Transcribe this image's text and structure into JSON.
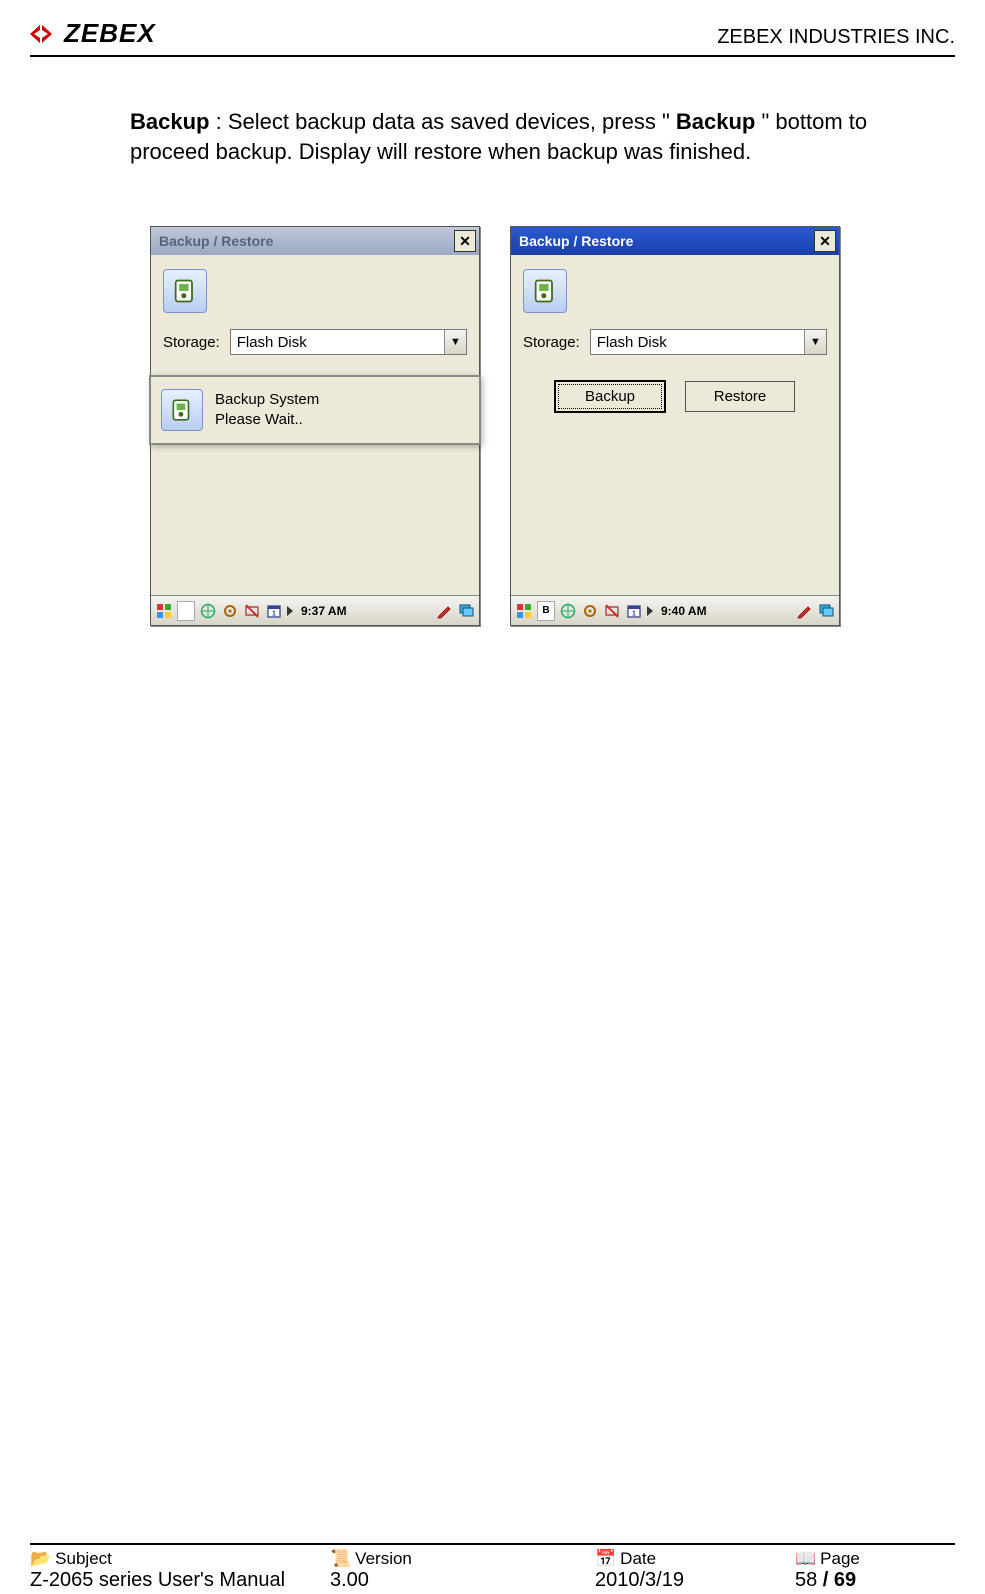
{
  "header": {
    "logo_text": "ZEBEX",
    "company": "ZEBEX INDUSTRIES INC."
  },
  "body": {
    "p1_bold1": "Backup",
    "p1_text1": " : Select backup data as saved devices, press \" ",
    "p1_bold2": "Backup",
    "p1_text2": " \" bottom to proceed backup. Display will restore when backup was finished."
  },
  "win_a": {
    "title": "Backup / Restore",
    "storage_label": "Storage:",
    "storage_value": "Flash Disk",
    "msg_line1": "Backup System",
    "msg_line2": "Please Wait..",
    "clock": "9:37 AM",
    "slot_char": ""
  },
  "win_b": {
    "title": "Backup / Restore",
    "storage_label": "Storage:",
    "storage_value": "Flash Disk",
    "btn_backup": "Backup",
    "btn_restore": "Restore",
    "clock": "9:40 AM",
    "slot_char": "B"
  },
  "footer": {
    "subject_label": "Subject",
    "subject_value": "Z-2065 series User's Manual",
    "version_label": "Version",
    "version_value": "3.00",
    "date_label": "Date",
    "date_value": "2010/3/19",
    "page_label": "Page",
    "page_value_a": "58",
    "page_sep": " / ",
    "page_value_b": "69"
  }
}
